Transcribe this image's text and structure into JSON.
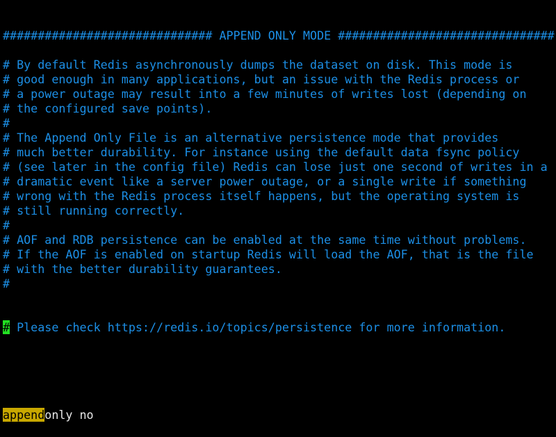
{
  "editor": {
    "lines": [
      "############################## APPEND ONLY MODE ###############################",
      "",
      "# By default Redis asynchronously dumps the dataset on disk. This mode is",
      "# good enough in many applications, but an issue with the Redis process or",
      "# a power outage may result into a few minutes of writes lost (depending on",
      "# the configured save points).",
      "#",
      "# The Append Only File is an alternative persistence mode that provides",
      "# much better durability. For instance using the default data fsync policy",
      "# (see later in the config file) Redis can lose just one second of writes in a",
      "# dramatic event like a server power outage, or a single write if something",
      "# wrong with the Redis process itself happens, but the operating system is",
      "# still running correctly.",
      "#",
      "# AOF and RDB persistence can be enabled at the same time without problems.",
      "# If the AOF is enabled on startup Redis will load the AOF, that is the file",
      "# with the better durability guarantees.",
      "#"
    ],
    "cursor_line": {
      "cursor_char": "#",
      "rest": " Please check https://redis.io/topics/persistence for more information."
    },
    "config_line": {
      "search_match": "append",
      "rest": "only no"
    },
    "colors": {
      "comment": "#1c8fe6",
      "cursor": "#22e022",
      "search_highlight": "#c8a800",
      "text": "#e8e8e8",
      "background": "#000000"
    }
  }
}
